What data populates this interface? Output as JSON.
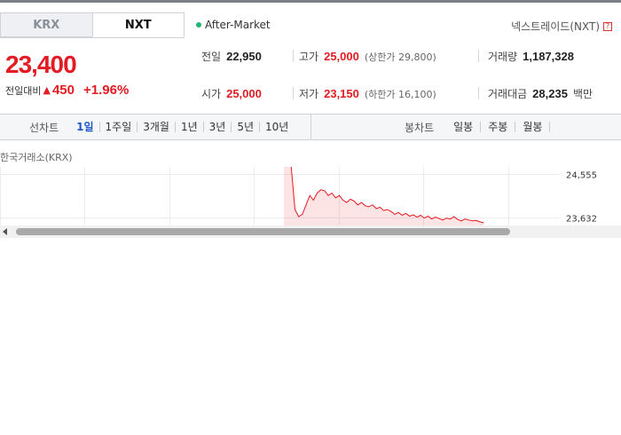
{
  "tabs": [
    {
      "label": "KRX",
      "active": false
    },
    {
      "label": "NXT",
      "active": true
    }
  ],
  "session_status": "After-Market",
  "nxt_link": "넥스트레이드(NXT)",
  "help_glyph": "?",
  "price": {
    "current": "23,400",
    "change_label": "전일대비",
    "change_arrow": "▲",
    "change_value": "450",
    "change_pct": "+1.96%"
  },
  "info": {
    "prev_close": {
      "label": "전일",
      "value": "22,950"
    },
    "high": {
      "label": "고가",
      "value": "25,000",
      "note": "(상한가 29,800)"
    },
    "volume": {
      "label": "거래량",
      "value": "1,187,328"
    },
    "open": {
      "label": "시가",
      "value": "25,000"
    },
    "low": {
      "label": "저가",
      "value": "23,150",
      "note": "(하한가 16,100)"
    },
    "turnover": {
      "label": "거래대금",
      "value": "28,235",
      "unit": "백만"
    }
  },
  "line_chart_tabs": {
    "label": "선차트",
    "items": [
      "1일",
      "1주일",
      "3개월",
      "1년",
      "3년",
      "5년",
      "10년"
    ],
    "selected": "1일"
  },
  "candle_chart_tabs": {
    "label": "봉차트",
    "items": [
      "일봉",
      "주봉",
      "월봉"
    ]
  },
  "exchange_caption": "한국거래소(KRX)",
  "chart_data": {
    "type": "area",
    "y_ticks": [
      24555,
      23632
    ],
    "y_tick_labels": [
      "24,555",
      "23,632"
    ],
    "grid": true,
    "series": [
      {
        "values": [
          25000,
          24980,
          24700,
          23800,
          23650,
          23700,
          23900,
          24100,
          24000,
          24150,
          24220,
          24200,
          24100,
          24150,
          24050,
          24100,
          24000,
          23950,
          24020,
          23980,
          23900,
          23950,
          23880,
          23860,
          23900,
          23820,
          23850,
          23780,
          23800,
          23760,
          23700,
          23740,
          23680,
          23720,
          23660,
          23690,
          23640,
          23680,
          23620,
          23660,
          23600,
          23640,
          23610,
          23580,
          23620,
          23600,
          23650,
          23590,
          23560,
          23600,
          23580,
          23560,
          23570,
          23540,
          23520
        ]
      }
    ],
    "color": "#e31b23"
  }
}
